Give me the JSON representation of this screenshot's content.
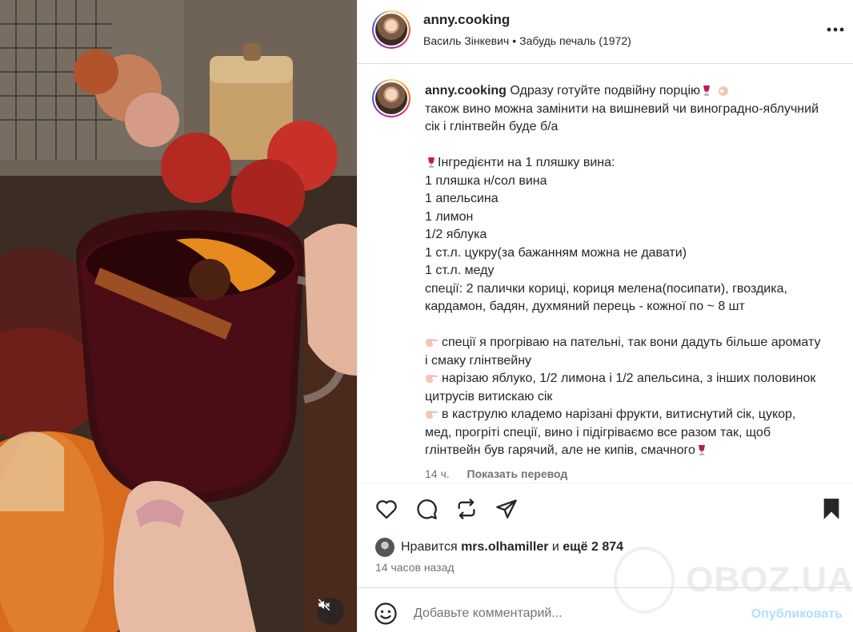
{
  "post": {
    "username": "anny.cooking",
    "audio": {
      "artist": "Василь Зінкевич",
      "separator": "•",
      "track": "Забудь печаль (1972)"
    },
    "caption": {
      "username": "anny.cooking",
      "line1": "Одразу готуйте подвійну порцію",
      "line2": "також вино можна замінити на вишневий чи виноградно-яблучний сік і глінтвейн буде б/а",
      "ingredients_title": "Інгредієнти на 1 пляшку вина:",
      "ingredients": [
        "1 пляшка н/сол вина",
        "1 апельсина",
        "1 лимон",
        "1/2 яблука",
        "1 ст.л. цукру(за бажанням можна не давати)",
        "1 ст.л. меду",
        "спеції: 2 палички кориці, кориця мелена(посипати), гвоздика, кардамон, бадян, духмяний перець - кожної по ~ 8 шт"
      ],
      "steps": [
        "спеції я прогріваю на пательні, так вони дадуть більше аромату і смаку глінтвейну",
        "нарізаю яблуко, 1/2 лимона і 1/2 апельсина, з інших половинок цитрусів витискаю сік",
        "в каструлю кладемо нарізані фрукти, витиснутий сік, цукор, мед, прогріті спеції, вино і підігріваємо все разом так, щоб глінтвейн був гарячий, але не кипів, смачного"
      ]
    },
    "caption_meta": {
      "time": "14 ч.",
      "translate_label": "Показать перевод"
    },
    "likes": {
      "prefix": "Нравится",
      "user": "mrs.olhamiller",
      "middle": "и",
      "count": "ещё 2 874"
    },
    "time_ago": "14 часов назад",
    "comment": {
      "placeholder": "Добавьте комментарий...",
      "publish_label": "Опубликовать"
    },
    "watermark": "OBOZ.UA"
  },
  "icons": {
    "more": "more-horizontal-icon",
    "like": "heart-icon",
    "comment": "comment-icon",
    "repost": "repost-icon",
    "share": "send-icon",
    "save": "bookmark-icon",
    "emoji": "smiley-icon",
    "mute": "speaker-muted-icon"
  },
  "colors": {
    "text": "#262626",
    "secondary": "#737373",
    "publish_disabled": "#b2dffc",
    "border": "#dbdbdb"
  }
}
